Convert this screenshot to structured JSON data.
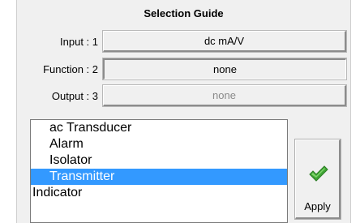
{
  "title": "Selection Guide",
  "rows": [
    {
      "label": "Input : 1",
      "value": "dc mA/V"
    },
    {
      "label": "Function : 2",
      "value": "none"
    },
    {
      "label": "Output : 3",
      "value": "none"
    }
  ],
  "list": {
    "items": [
      "ac Transducer",
      "Alarm",
      "Isolator",
      "Transmitter",
      "Indicator"
    ],
    "selected": "Transmitter"
  },
  "apply": {
    "label": "Apply",
    "icon": "checkmark-icon",
    "icon_color": "#3fa535"
  },
  "colors": {
    "selection": "#3399ff",
    "panel": "#f0f0f0"
  }
}
